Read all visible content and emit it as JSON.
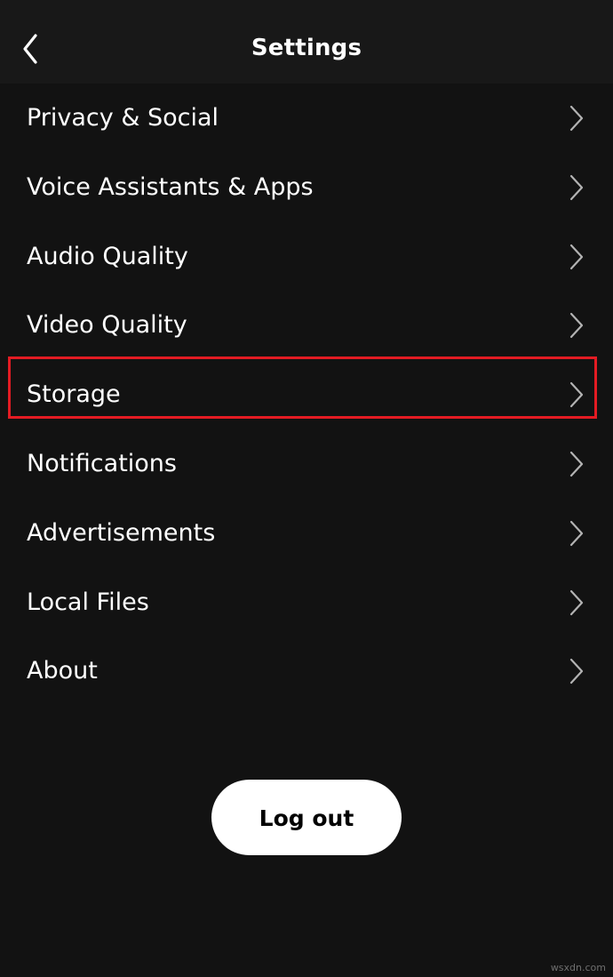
{
  "header": {
    "title": "Settings",
    "back_icon": "chevron-left-icon"
  },
  "menu": {
    "items": [
      {
        "label": "Privacy & Social",
        "icon": "chevron-right-icon"
      },
      {
        "label": "Voice Assistants & Apps",
        "icon": "chevron-right-icon"
      },
      {
        "label": "Audio Quality",
        "icon": "chevron-right-icon"
      },
      {
        "label": "Video Quality",
        "icon": "chevron-right-icon"
      },
      {
        "label": "Storage",
        "icon": "chevron-right-icon",
        "highlighted": true
      },
      {
        "label": "Notifications",
        "icon": "chevron-right-icon"
      },
      {
        "label": "Advertisements",
        "icon": "chevron-right-icon"
      },
      {
        "label": "Local Files",
        "icon": "chevron-right-icon"
      },
      {
        "label": "About",
        "icon": "chevron-right-icon"
      }
    ]
  },
  "logout": {
    "label": "Log out"
  },
  "watermark": "wsxdn.com",
  "colors": {
    "background": "#121212",
    "header_background": "#181818",
    "text": "#ffffff",
    "chevron": "#b3b3b3",
    "highlight_border": "#e31b23",
    "button_background": "#ffffff",
    "button_text": "#000000"
  }
}
